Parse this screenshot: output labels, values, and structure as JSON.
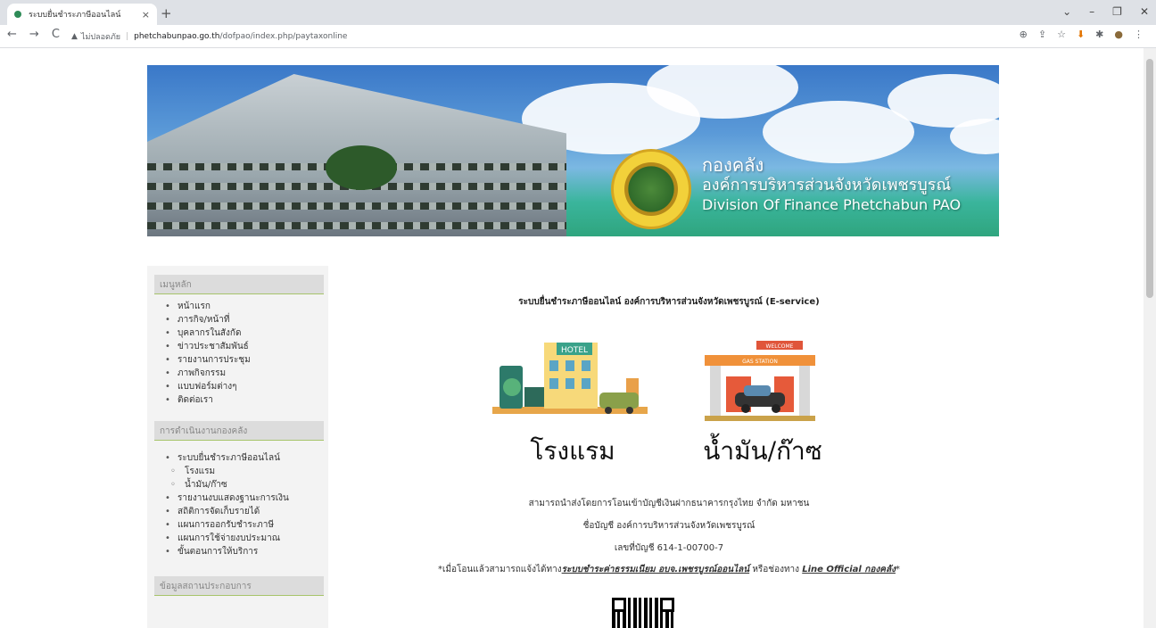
{
  "browser": {
    "tab_title": "ระบบยื่นชำระภาษีออนไลน์",
    "tab_close": "×",
    "new_tab": "+",
    "window_controls": [
      "⌄",
      "–",
      "❐",
      "✕"
    ],
    "nav": [
      "←",
      "→",
      "C"
    ],
    "security_label": "ไม่ปลอดภัย",
    "url_host": "phetchabunpao.go.th",
    "url_path": "/dofpao/index.php/paytaxonline",
    "ext_icons": [
      "⊕",
      "⇪",
      "☆",
      "⬇",
      "✱",
      "●",
      "⋮"
    ]
  },
  "banner": {
    "title_th": "กองคลัง",
    "org_th": "องค์การบริหารส่วนจังหวัดเพชรบูรณ์",
    "org_en": "Division Of Finance Phetchabun PAO"
  },
  "sidebar": {
    "main_menu_title": "เมนูหลัก",
    "main_menu": [
      "หน้าแรก",
      "ภารกิจ/หน้าที่",
      "บุคลากรในสังกัด",
      "ข่าวประชาสัมพันธ์",
      "รายงานการประชุม",
      "ภาพกิจกรรม",
      "แบบฟอร์มต่างๆ",
      "ติดต่อเรา"
    ],
    "ops_title": "การดำเนินงานกองคลัง",
    "ops_menu": [
      {
        "label": "ระบบยื่นชำระภาษีออนไลน์",
        "sub": false
      },
      {
        "label": "โรงแรม",
        "sub": true
      },
      {
        "label": "น้ำมัน/ก๊าซ",
        "sub": true
      },
      {
        "label": "รายงานงบแสดงฐานะการเงิน",
        "sub": false
      },
      {
        "label": "สถิติการจัดเก็บรายได้",
        "sub": false
      },
      {
        "label": "แผนการออกรับชำระภาษี",
        "sub": false
      },
      {
        "label": "แผนการใช้จ่ายงบประมาณ",
        "sub": false
      },
      {
        "label": "ขั้นตอนการให้บริการ",
        "sub": false
      }
    ],
    "third_title": "ข้อมูลสถานประกอบการ"
  },
  "main": {
    "heading": "ระบบยื่นชำระภาษีออนไลน์ องค์การบริหารส่วนจังหวัดเพชรบูรณ์ (E-service)",
    "hotel_sign": "HOTEL",
    "hotel_label": "โรงแรม",
    "gas_sign": "WELCOME",
    "gas_station_sign": "GAS STATION",
    "gas_label": "น้ำมัน/ก๊าซ",
    "info_line1": "สามารถนำส่งโดยการโอนเข้าบัญชีเงินฝากธนาคารกรุงไทย จำกัด มหาชน",
    "info_line2": "ชื่อบัญชี องค์การบริหารส่วนจังหวัดเพชรบูรณ์",
    "info_line3": "เลขที่บัญชี 614-1-00700-7",
    "note_prefix": "*เมื่อโอนแล้วสามารถแจ้งได้ทาง",
    "note_link1": "ระบบชำระค่าธรรมเนียม อบจ.เพชรบูรณ์ออนไลน์",
    "note_mid": " หรือช่องทาง ",
    "note_link2": "Line Official กองคลัง",
    "note_suffix": "*"
  }
}
